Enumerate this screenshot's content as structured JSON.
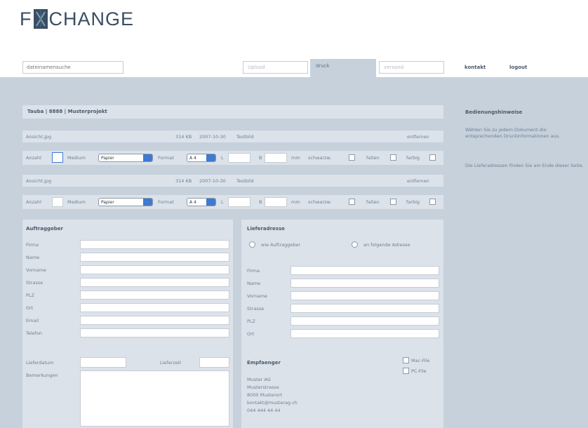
{
  "logo": {
    "left": "F",
    "right": "CHANGE"
  },
  "search": {
    "placeholder": "dateinamensuche"
  },
  "tabs": [
    {
      "label": "Upload"
    },
    {
      "label": "druck"
    },
    {
      "label": "versand"
    }
  ],
  "toplinks": [
    "kontakt",
    "logout"
  ],
  "title": "Tauba | 8888 | Musterprojekt",
  "files": [
    {
      "name": "Ansicht.jpg",
      "size": "314 KB",
      "date": "2007-10-30",
      "time": "Testbild",
      "action": "entfernen",
      "options": {
        "anzahl_label": "Anzahl",
        "medium_label": "Medium",
        "medium_value": "Papier",
        "format_label": "Format",
        "format_value": "A 4",
        "l_label": "L",
        "b_label": "B",
        "unit": "mm",
        "schwarzweiss": "schwarzw.",
        "falten": "falten",
        "farbig": "farbig"
      }
    },
    {
      "name": "Ansicht.jpg",
      "size": "314 KB",
      "date": "2007-10-30",
      "time": "Testbild",
      "action": "entfernen",
      "options": {
        "anzahl_label": "Anzahl",
        "medium_label": "Medium",
        "medium_value": "Papier",
        "format_label": "Format",
        "format_value": "A 4",
        "l_label": "L",
        "b_label": "B",
        "unit": "mm",
        "schwarzweiss": "schwarzw.",
        "falten": "falten",
        "farbig": "farbig"
      }
    }
  ],
  "auftraggeber": {
    "heading": "Auftraggeber",
    "fields": [
      "Firma",
      "Name",
      "Vorname",
      "Strasse",
      "PLZ",
      "Ort",
      "Email",
      "Telefon"
    ],
    "liefdatum": "Lieferdatum",
    "liefzeit": "Lieferzeit",
    "bemerkungen": "Bemerkungen"
  },
  "lieferadresse": {
    "heading": "Lieferadresse",
    "radio1": "wie Auftraggeber",
    "radio2": "an folgende Adresse",
    "fields": [
      "Firma",
      "Name",
      "Vorname",
      "Strasse",
      "PLZ",
      "Ort"
    ]
  },
  "empfaenger": {
    "heading": "Empfaenger",
    "lines": [
      "Muster AG",
      "Musterstrasse",
      "8000 Musterort",
      "kontakt@musterag.ch",
      "044 444 44 44"
    ],
    "check1": "Mac-File",
    "check2": "PC-File"
  },
  "sidebar": {
    "title": "Bedienungshinweise",
    "text1": "Wählen Sie zu jedem Dokument die entsprechenden Druckinformationen aus.",
    "text2": "Die Lieferadressen finden Sie am Ende dieser Seite."
  }
}
